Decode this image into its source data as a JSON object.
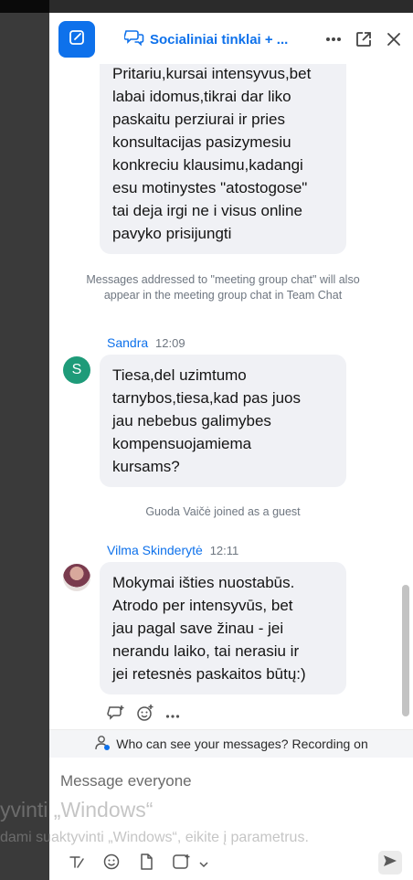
{
  "header": {
    "chat_title": "Socialiniai tinklai + ...",
    "compose_icon": "compose-icon",
    "chat_icon": "chat-bubbles-icon",
    "more_icon": "more-icon",
    "popout_icon": "popout-icon",
    "close_icon": "close-icon"
  },
  "messages": {
    "first_bubble": [
      "Pritariu,kursai intensyvus,bet",
      "labai idomus,tikrai dar liko",
      "paskaitu perziurai ir pries",
      "konsultacijas pasizymesiu",
      "konkreciu klausimu,kadangi",
      "esu motinystes \"atostogose\"",
      "tai deja irgi ne i visus online",
      "pavyko prisijungti"
    ],
    "system_note": "Messages addressed to \"meeting group chat\" will also appear in the meeting group chat in Team Chat",
    "sandra": {
      "name": "Sandra",
      "time": "12:09",
      "avatar_letter": "S",
      "lines": [
        "Tiesa,del uzimtumo",
        "tarnybos,tiesa,kad pas juos",
        "jau nebebus galimybes",
        "kompensuojamiema",
        "kursams?"
      ]
    },
    "guest_note": "Guoda Vaičė joined as a guest",
    "vilma": {
      "name": "Vilma Skinderytė",
      "time": "12:11",
      "lines": [
        "Mokymai išties nuostabūs.",
        "Atrodo per intensyvūs, bet",
        "jau pagal save žinau - jei",
        "nerandu laiko, tai nerasiu ir",
        "jei retesnės paskaitos būtų:)"
      ]
    },
    "reply_icon": "reply-icon",
    "emoji_icon": "add-reaction-icon",
    "more_actions_icon": "more-icon"
  },
  "privacy": {
    "text": "Who can see your messages? Recording on",
    "icon": "person-privacy-icon"
  },
  "input": {
    "placeholder": "Message everyone"
  },
  "toolbar": {
    "icons": [
      "format-icon",
      "emoji-icon",
      "file-icon",
      "screenshot-icon",
      "chevron-down-icon",
      "send-icon"
    ]
  },
  "watermark": {
    "line1": "yvinti „Windows“",
    "line2": "dami suaktyvinti „Windows“, eikite į parametrus."
  },
  "colors": {
    "accent": "#0e71eb",
    "bubble": "#f0f1f5",
    "sandra_avatar": "#1e9b79"
  }
}
